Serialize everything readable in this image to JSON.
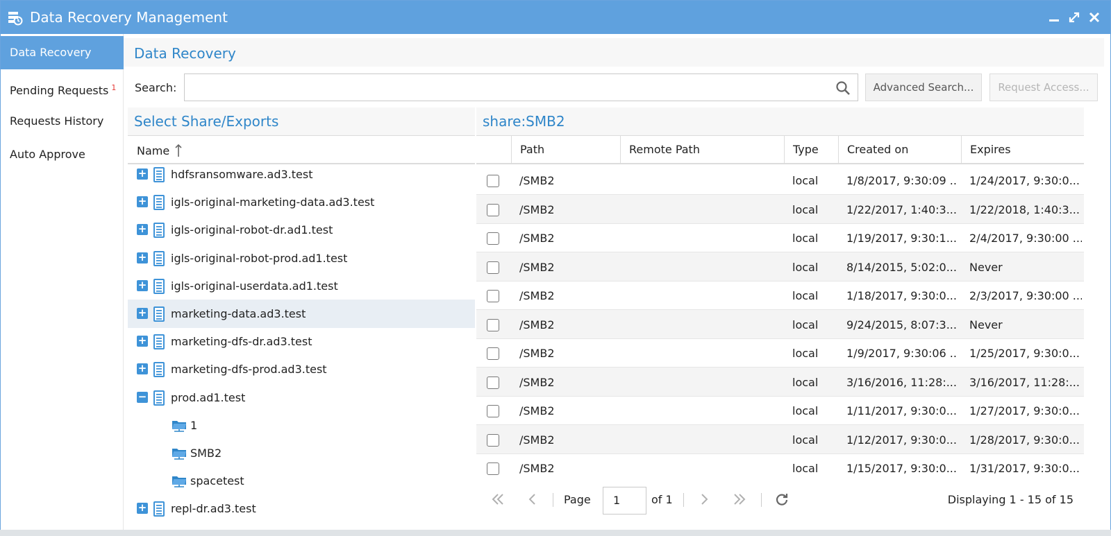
{
  "window": {
    "title": "Data Recovery Management",
    "minimize_icon": "minimize-icon",
    "maximize_icon": "maximize-icon",
    "close_icon": "close-icon"
  },
  "sidebar": {
    "items": [
      {
        "label": "Data Recovery",
        "active": true
      },
      {
        "label": "Pending Requests",
        "badge": "1"
      },
      {
        "label": "Requests History"
      },
      {
        "label": "Auto Approve"
      }
    ]
  },
  "main": {
    "title": "Data Recovery",
    "search": {
      "label": "Search:",
      "value": "",
      "placeholder": ""
    },
    "advanced_search_label": "Advanced Search...",
    "request_access_label": "Request Access..."
  },
  "tree": {
    "title": "Select Share/Exports",
    "column": "Name",
    "rows": [
      {
        "name": "hdfsransomware.ad3.test",
        "type": "server",
        "state": "collapsed"
      },
      {
        "name": "igls-original-marketing-data.ad3.test",
        "type": "server",
        "state": "collapsed"
      },
      {
        "name": "igls-original-robot-dr.ad1.test",
        "type": "server",
        "state": "collapsed"
      },
      {
        "name": "igls-original-robot-prod.ad1.test",
        "type": "server",
        "state": "collapsed"
      },
      {
        "name": "igls-original-userdata.ad1.test",
        "type": "server",
        "state": "collapsed"
      },
      {
        "name": "marketing-data.ad3.test",
        "type": "server",
        "state": "collapsed",
        "selected": true
      },
      {
        "name": "marketing-dfs-dr.ad3.test",
        "type": "server",
        "state": "collapsed"
      },
      {
        "name": "marketing-dfs-prod.ad3.test",
        "type": "server",
        "state": "collapsed"
      },
      {
        "name": "prod.ad1.test",
        "type": "server",
        "state": "expanded"
      },
      {
        "name": "1",
        "type": "share"
      },
      {
        "name": "SMB2",
        "type": "share"
      },
      {
        "name": "spacetest",
        "type": "share"
      },
      {
        "name": "repl-dr.ad3.test",
        "type": "server",
        "state": "collapsed"
      }
    ]
  },
  "grid": {
    "title": "share:SMB2",
    "columns": [
      "Path",
      "Remote Path",
      "Type",
      "Created on",
      "Expires"
    ],
    "rows": [
      {
        "path": "/SMB2",
        "remote": "",
        "type": "local",
        "created": "1/8/2017, 9:30:09 ...",
        "expires": "1/24/2017, 9:30:0..."
      },
      {
        "path": "/SMB2",
        "remote": "",
        "type": "local",
        "created": "1/22/2017, 1:40:3...",
        "expires": "1/22/2018, 1:40:3..."
      },
      {
        "path": "/SMB2",
        "remote": "",
        "type": "local",
        "created": "1/19/2017, 9:30:1...",
        "expires": "2/4/2017, 9:30:00 ..."
      },
      {
        "path": "/SMB2",
        "remote": "",
        "type": "local",
        "created": "8/14/2015, 5:02:0...",
        "expires": "Never"
      },
      {
        "path": "/SMB2",
        "remote": "",
        "type": "local",
        "created": "1/18/2017, 9:30:0...",
        "expires": "2/3/2017, 9:30:00 ..."
      },
      {
        "path": "/SMB2",
        "remote": "",
        "type": "local",
        "created": "9/24/2015, 8:07:3...",
        "expires": "Never"
      },
      {
        "path": "/SMB2",
        "remote": "",
        "type": "local",
        "created": "1/9/2017, 9:30:06 ...",
        "expires": "1/25/2017, 9:30:0..."
      },
      {
        "path": "/SMB2",
        "remote": "",
        "type": "local",
        "created": "3/16/2016, 11:28:...",
        "expires": "3/16/2017, 11:28:..."
      },
      {
        "path": "/SMB2",
        "remote": "",
        "type": "local",
        "created": "1/11/2017, 9:30:0...",
        "expires": "1/27/2017, 9:30:0..."
      },
      {
        "path": "/SMB2",
        "remote": "",
        "type": "local",
        "created": "1/12/2017, 9:30:0...",
        "expires": "1/28/2017, 9:30:0..."
      },
      {
        "path": "/SMB2",
        "remote": "",
        "type": "local",
        "created": "1/15/2017, 9:30:0...",
        "expires": "1/31/2017, 9:30:0..."
      }
    ],
    "pager": {
      "page_label": "Page",
      "page_value": "1",
      "of_label": "of 1",
      "display": "Displaying 1 - 15 of 15"
    }
  },
  "colors": {
    "accent": "#5fa1de",
    "title_text": "#2f86c9",
    "badge": "#e53935"
  }
}
